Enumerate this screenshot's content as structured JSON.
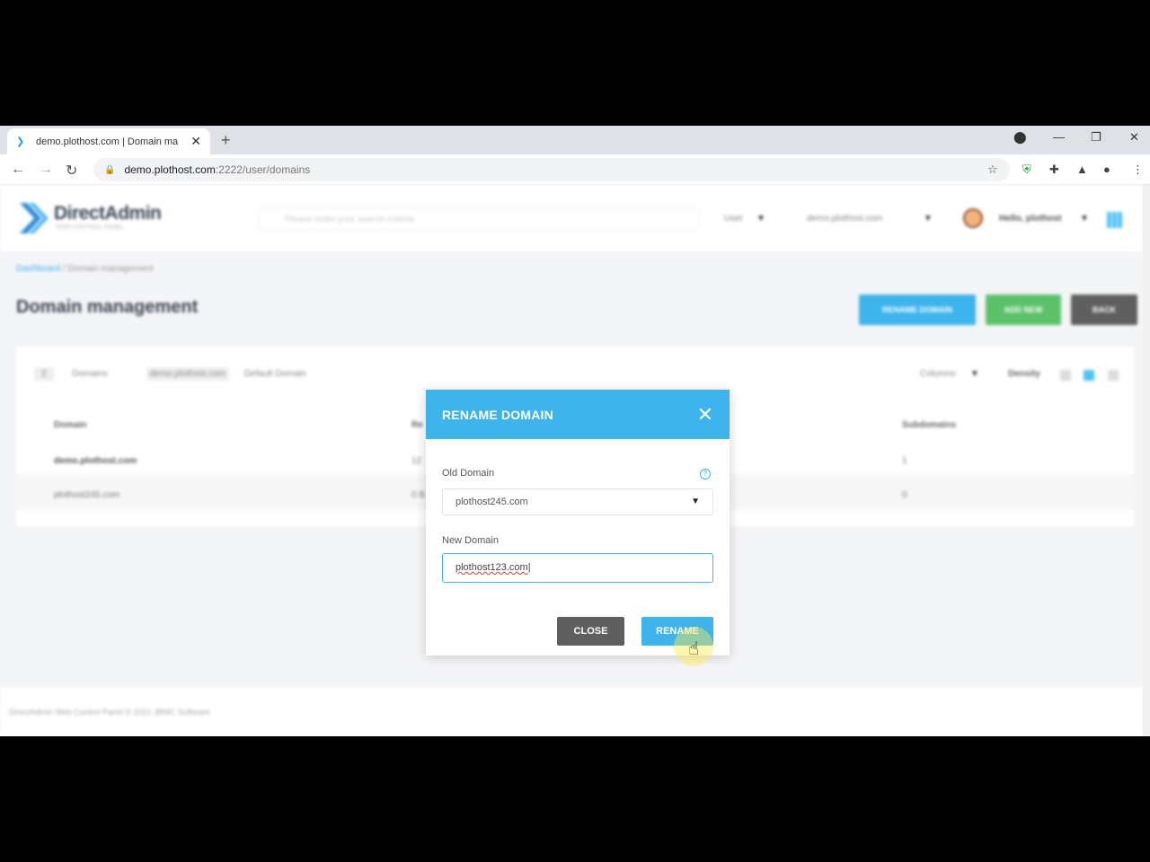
{
  "browser": {
    "tab_title": "demo.plothost.com | Domain ma",
    "tab_close": "✕",
    "new_tab": "+",
    "url_host": "demo.plothost.com",
    "url_path": ":2222/user/domains"
  },
  "app": {
    "logo_text": "DirectAdmin",
    "logo_sub": "WEB CONTROL PANEL",
    "search_placeholder": "Please enter your search criteria",
    "level_select": "User",
    "domain_select": "demo.plothost.com",
    "user_greeting": "Hello, plothost"
  },
  "breadcrumb": {
    "home": "Dashboard",
    "separator": " / ",
    "current": "Domain management"
  },
  "page": {
    "title": "Domain management",
    "buttons": {
      "rename": "RENAME DOMAIN",
      "add": "ADD NEW",
      "back": "BACK"
    },
    "filters": {
      "count": "2",
      "domains_label": "Domains",
      "default_domain_value": "demo.plothost.com",
      "default_domain_label": "Default Domain",
      "columns": "Columns",
      "density": "Density"
    },
    "table": {
      "headers": [
        "Domain",
        "Re",
        "Subdomains"
      ],
      "rows": [
        {
          "domain": "demo.plothost.com",
          "col2": "12",
          "subdomains": "1"
        },
        {
          "domain": "plothost245.com",
          "col2": "0 B",
          "subdomains": "0"
        }
      ]
    },
    "footer": "DirectAdmin Web Control Panel © 2021 JBMC Software"
  },
  "modal": {
    "title": "RENAME DOMAIN",
    "old_domain_label": "Old Domain",
    "old_domain_value": "plothost245.com",
    "help": "?",
    "new_domain_label": "New Domain",
    "new_domain_value": "plothost123.com",
    "close_label": "CLOSE",
    "rename_label": "RENAME"
  },
  "colors": {
    "accent": "#3db4ec",
    "green": "#5cc26a",
    "dark_button": "#5f5f5f"
  }
}
